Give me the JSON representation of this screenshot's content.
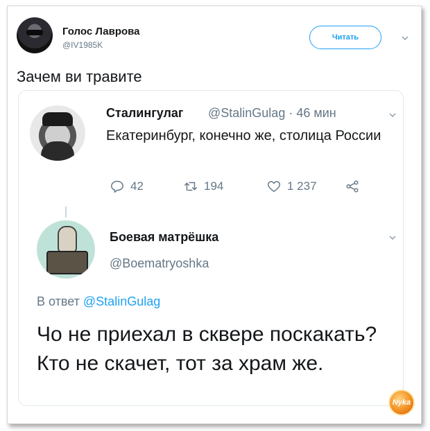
{
  "tweet": {
    "author_name": "Голос Лаврова",
    "author_handle": "@IV1985K",
    "follow_label": "Читать",
    "text": "Зачем ви травите"
  },
  "quoted": {
    "author_name": "Сталингулаг",
    "author_meta": "@StalinGulag · 46 мин",
    "text": "Екатеринбург, конечно же, столица России",
    "reply_count": "42",
    "retweet_count": "194",
    "like_count": "1 237"
  },
  "reply": {
    "author_name": "Боевая матрёшка",
    "author_handle": "@Boematryoshka",
    "reply_prefix": "В ответ",
    "reply_target": "@StalinGulag",
    "text": "Чо не приехал в сквере поскакать? Кто не скачет, тот за храм же."
  },
  "watermark": {
    "text": "Nyka"
  },
  "icons": [
    "chevron-down-icon",
    "reply-icon",
    "retweet-icon",
    "like-icon",
    "share-icon"
  ],
  "colors": {
    "accent": "#1da1f2",
    "muted": "#657786",
    "text": "#14171a"
  }
}
